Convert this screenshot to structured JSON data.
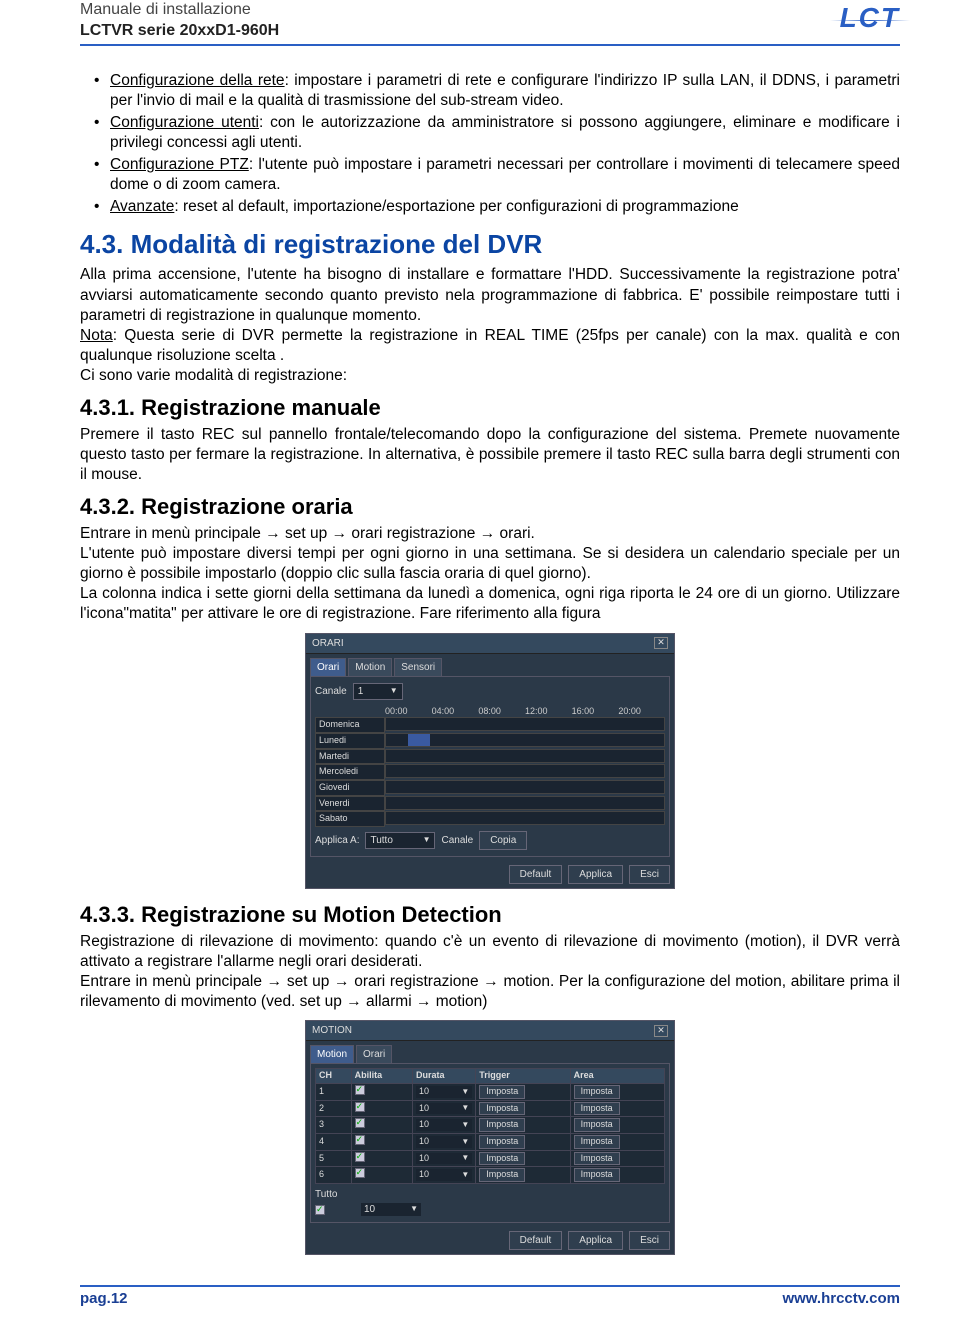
{
  "header": {
    "line1": "Manuale di installazione",
    "line2": "LCTVR serie 20xxD1-960H",
    "logo": "LCT"
  },
  "bullets": {
    "b1_label": "Configurazione della rete",
    "b1_rest": ": impostare i parametri di rete e configurare l'indirizzo IP sulla LAN, il DDNS, i parametri per l'invio di mail e la qualità di trasmissione del sub-stream  video.",
    "b2_label": "Configurazione utenti",
    "b2_rest": ": con le autorizzazione da amministratore si possono aggiungere, eliminare e modificare i privilegi concessi agli utenti.",
    "b3_label": "Configurazione PTZ",
    "b3_rest": ": l'utente può impostare i parametri necessari per controllare i movimenti di telecamere speed dome o  di zoom camera.",
    "b4_label": "Avanzate",
    "b4_rest": ": reset al default, importazione/esportazione per configurazioni di programmazione"
  },
  "sec43": {
    "title": "4.3. Modalità di registrazione del DVR",
    "p1": "Alla prima accensione, l'utente ha bisogno di installare e formattare l'HDD. Successivamente la registrazione potra' avviarsi automaticamente secondo quanto previsto nela programmazione di fabbrica. E' possibile reimpostare tutti i parametri di registrazione in qualunque momento.",
    "note_label": "Nota",
    "note_rest": ": Questa serie di DVR permette la registrazione in REAL TIME (25fps per canale) con la max. qualità e con qualunque risoluzione scelta .",
    "p3": "Ci sono varie modalità di registrazione:"
  },
  "sec431": {
    "title": "4.3.1. Registrazione manuale",
    "p": "Premere il tasto REC sul pannello frontale/telecomando dopo la configurazione del sistema. Premete nuovamente questo tasto per fermare la registrazione. In alternativa, è possibile premere il tasto REC sulla barra degli strumenti con il mouse."
  },
  "sec432": {
    "title": "4.3.2. Registrazione oraria",
    "p1": "Entrare in menù principale → set up → orari registrazione → orari.",
    "p2": "L'utente può impostare diversi tempi per ogni giorno in una settimana. Se si desidera un calendario speciale per un giorno è possibile impostarlo (doppio clic sulla fascia oraria di quel giorno).",
    "p3": "La colonna indica i sette giorni della settimana da lunedì a domenica, ogni riga riporta le 24 ore di un giorno.  Utilizzare l'icona\"matita\" per attivare le ore di registrazione. Fare riferimento alla figura"
  },
  "orari_ui": {
    "title": "ORARI",
    "tabs": [
      "Orari",
      "Motion",
      "Sensori"
    ],
    "label_canale": "Canale",
    "canale_val": "1",
    "times": [
      "00:00",
      "04:00",
      "08:00",
      "12:00",
      "16:00",
      "20:00"
    ],
    "days": [
      "Domenica",
      "Lunedi",
      "Martedi",
      "Mercoledi",
      "Giovedi",
      "Venerdi",
      "Sabato"
    ],
    "filled_day_index": 1,
    "applica_label": "Applica A:",
    "tutto_label": "Tutto",
    "canale_label": "Canale",
    "copia_label": "Copia",
    "default_btn": "Default",
    "applica_btn": "Applica",
    "esci_btn": "Esci"
  },
  "sec433": {
    "title": "4.3.3. Registrazione su Motion Detection",
    "p1": "Registrazione di rilevazione di movimento: quando c'è un evento di rilevazione di movimento (motion), il DVR verrà attivato a registrare l'allarme negli orari desiderati.",
    "p2": "Entrare in menù principale → set up → orari registrazione → motion. Per la configurazione del motion, abilitare prima il rilevamento di movimento (ved. set up → allarmi → motion)"
  },
  "motion_ui": {
    "title": "MOTION",
    "tabs": [
      "Motion",
      "Orari"
    ],
    "col_ch": "CH",
    "col_abilita": "Abilita",
    "col_durata": "Durata",
    "col_trigger": "Trigger",
    "col_area": "Area",
    "rows": [
      {
        "ch": "1",
        "durata": "10",
        "trigger": "Imposta",
        "area": "Imposta"
      },
      {
        "ch": "2",
        "durata": "10",
        "trigger": "Imposta",
        "area": "Imposta"
      },
      {
        "ch": "3",
        "durata": "10",
        "trigger": "Imposta",
        "area": "Imposta"
      },
      {
        "ch": "4",
        "durata": "10",
        "trigger": "Imposta",
        "area": "Imposta"
      },
      {
        "ch": "5",
        "durata": "10",
        "trigger": "Imposta",
        "area": "Imposta"
      },
      {
        "ch": "6",
        "durata": "10",
        "trigger": "Imposta",
        "area": "Imposta"
      }
    ],
    "tutto_label": "Tutto",
    "tutto_durata": "10",
    "default_btn": "Default",
    "applica_btn": "Applica",
    "esci_btn": "Esci"
  },
  "footer": {
    "page_label": "pag.",
    "page_num": "12",
    "url": "www.hrcctv.com"
  }
}
